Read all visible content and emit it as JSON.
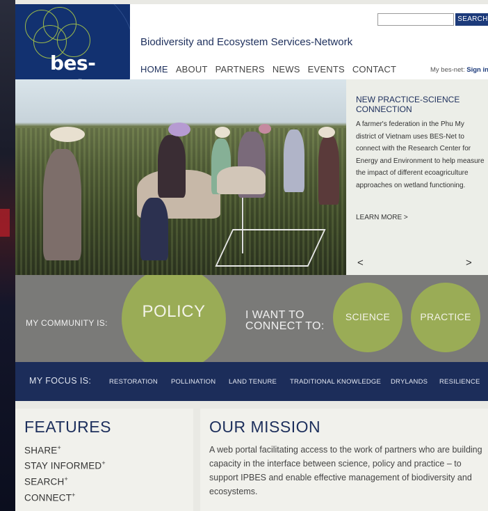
{
  "colors": {
    "navy": "#123170",
    "accent_green": "#9aac56",
    "community_gray": "#7a7a78",
    "focus_bar": "#1c2d5a",
    "title_blue": "#1d2f5c"
  },
  "logo": {
    "text": "bes-net"
  },
  "header": {
    "search_button": "SEARCH",
    "search_value": "",
    "tagline": "Biodiversity and Ecosystem Services-Network",
    "nav": [
      "HOME",
      "ABOUT",
      "PARTNERS",
      "NEWS",
      "EVENTS",
      "CONTACT"
    ],
    "my_besnet_label": "My bes-net:",
    "sign_in": "Sign in"
  },
  "hero": {
    "title": "NEW PRACTICE-SCIENCE CONNECTION",
    "text": "A farmer's federation in the Phu My district of Vietnam uses BES-Net to connect with the Research Center for Energy and Environment to help measure the impact of different ecoagriculture approaches on wetland functioning.",
    "learn_more": "LEARN MORE >",
    "prev": "<",
    "next": ">"
  },
  "community": {
    "label": "MY COMMUNITY IS:",
    "selected": "POLICY",
    "connect_label_line1": "I WANT TO",
    "connect_label_line2": "CONNECT TO:",
    "options": [
      "SCIENCE",
      "PRACTICE"
    ]
  },
  "focus": {
    "label": "MY FOCUS IS:",
    "items": [
      "RESTORATION",
      "POLLINATION",
      "LAND TENURE",
      "TRADITIONAL KNOWLEDGE",
      "DRYLANDS",
      "RESILIENCE"
    ]
  },
  "features": {
    "title": "FEATURES",
    "items": [
      "SHARE",
      "STAY INFORMED",
      "SEARCH",
      "CONNECT"
    ],
    "suffix": "+"
  },
  "mission": {
    "title": "OUR MISSION",
    "text": "A web portal facilitating access to the work of partners who are building capacity in the interface between science, policy and practice – to support IPBES and enable effective management of biodiversity and ecosystems."
  }
}
